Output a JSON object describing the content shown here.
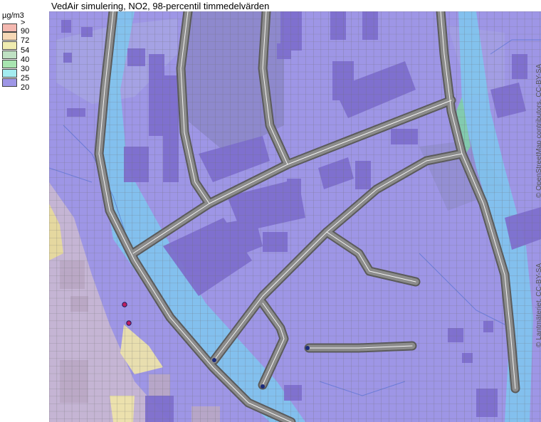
{
  "title": "VedAir simulering, NO2, 98-percentil timmedelvärden",
  "legend": {
    "unit": "µg/m3",
    "open_top": ">",
    "classes": [
      {
        "label": "90",
        "color": "#f4b8b0"
      },
      {
        "label": "72",
        "color": "#f6d8b6"
      },
      {
        "label": "54",
        "color": "#f0ecb0"
      },
      {
        "label": "40",
        "color": "#bfe1c3"
      },
      {
        "label": "30",
        "color": "#a8e5b0"
      },
      {
        "label": "25",
        "color": "#a3ecf0"
      },
      {
        "label": "20",
        "color": "#9e96e6"
      }
    ]
  },
  "credits": {
    "osm": "© OpenStreetMap contributors, CC-BY-SA",
    "lantmateriet": "© Lantmäteriet, CC-BY-SA"
  },
  "colors": {
    "background": "#9e96e6",
    "cyan_band": "#7ec8ee",
    "road": "#7a7a7a",
    "building": "#7e6fce",
    "grid": "#6d6d6d"
  }
}
